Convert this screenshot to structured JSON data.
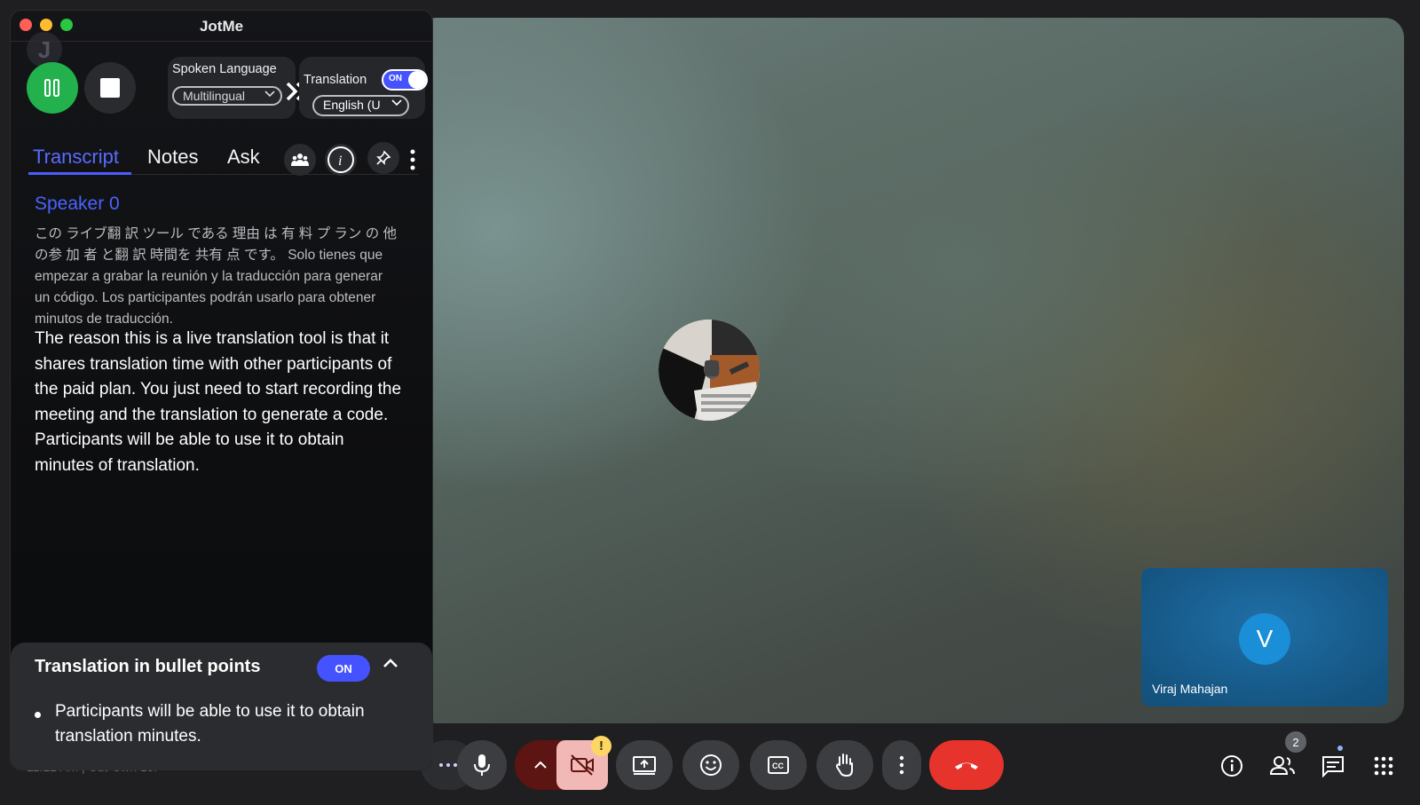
{
  "meet": {
    "participant_tile": {
      "initial": "V",
      "name": "Viraj Mahajan"
    },
    "participants_count": "2",
    "warning_badge": "!",
    "bottom_left_text": "11:12 AM  |  Cut-Cwh-z5f",
    "controls": [
      "more-options",
      "microphone",
      "camera-options",
      "camera-off",
      "present-screen",
      "reactions",
      "captions",
      "raise-hand",
      "more-actions",
      "end-call"
    ],
    "right_controls": [
      "meeting-info",
      "people",
      "chat",
      "activities"
    ],
    "colors": {
      "end_call": "#e6332c",
      "camera_off": "#f2b8b5",
      "tile_bg": "#155582"
    }
  },
  "jotme": {
    "title": "JotMe",
    "ghost_initial": "J",
    "spoken_language": {
      "label": "Spoken Language",
      "value": "Multilingual"
    },
    "translation": {
      "label": "Translation",
      "toggle": "ON",
      "value": "English (U"
    },
    "tabs": [
      {
        "label": "Transcript",
        "active": true
      },
      {
        "label": "Notes",
        "active": false
      },
      {
        "label": "Ask",
        "active": false
      }
    ],
    "transcript": {
      "speaker": "Speaker 0",
      "original": "この ライブ翻 訳 ツール である 理由 は 有 料 プ ラン の 他 の参 加 者 と翻 訳 時間を 共有 点 です。 Solo tienes que empezar a grabar la reunión y la traducción para generar un código. Los participantes podrán usarlo para obtener minutos de traducción.",
      "translated": "The reason this is a live translation tool is that it shares translation time with other participants of the paid plan. You just need to start recording the meeting and the translation to generate a code. Participants will be able to use it to obtain minutes of translation."
    },
    "bullets": {
      "title": "Translation in bullet points",
      "toggle": "ON",
      "items": [
        "Participants will be able to use it to obtain translation minutes."
      ]
    },
    "colors": {
      "accent": "#4452ff",
      "pause_green": "#22b14c",
      "speaker_blue": "#4b63ff"
    }
  }
}
